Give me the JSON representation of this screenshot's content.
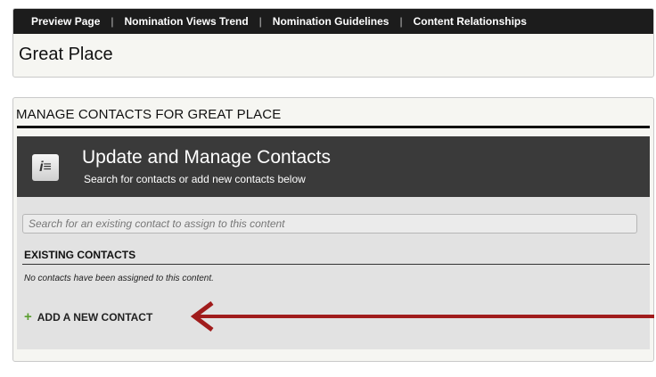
{
  "nav": {
    "links": [
      "Preview Page",
      "Nomination Views Trend",
      "Nomination Guidelines",
      "Content Relationships"
    ],
    "separator": "|"
  },
  "page": {
    "title": "Great Place"
  },
  "panel": {
    "heading": "MANAGE CONTACTS FOR GREAT PLACE",
    "header": {
      "title": "Update and Manage Contacts",
      "subtitle": "Search for contacts or add new contacts below",
      "icon": "contacts-list-icon"
    },
    "search": {
      "placeholder": "Search for an existing contact to assign to this content",
      "value": ""
    },
    "existing_label": "EXISTING CONTACTS",
    "empty_message": "No contacts have been assigned to this content.",
    "add_label": "ADD A NEW CONTACT"
  },
  "colors": {
    "accent_arrow": "#a01c1c",
    "plus": "#5a9e2f",
    "dark_header": "#3a3a3a"
  }
}
